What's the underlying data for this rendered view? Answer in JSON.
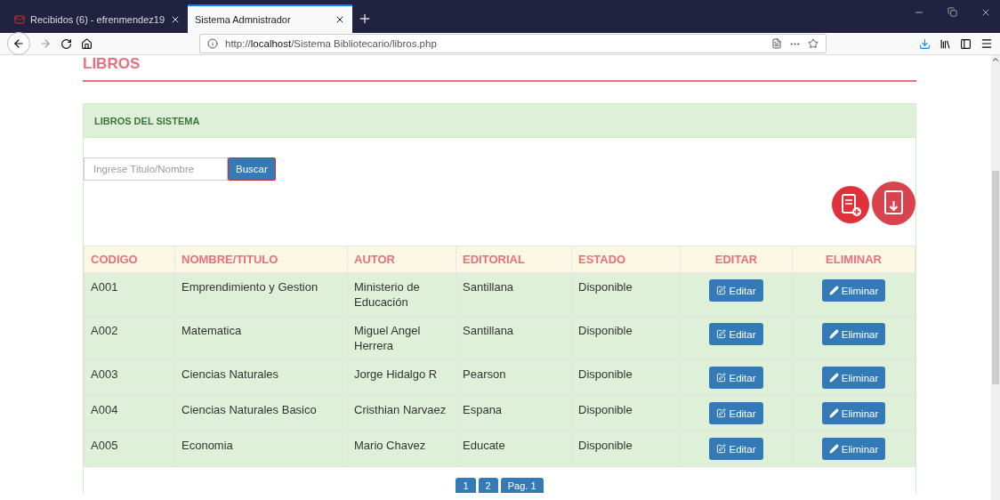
{
  "browser": {
    "tabs": [
      {
        "title": "Recibidos (6) - efrenmendez19",
        "selected": false
      },
      {
        "title": "Sistema Admnistrador",
        "selected": true
      }
    ],
    "url_prefix": "http://",
    "url_host": "localhost",
    "url_path": "/Sistema Bibliotecario/libros.php"
  },
  "page": {
    "heading": "LIBROS",
    "panel_title": "LIBROS DEL SISTEMA",
    "search": {
      "placeholder": "Ingrese Titulo/Nombre",
      "button": "Buscar"
    },
    "table": {
      "columns": [
        "CODIGO",
        "NOMBRE/TITULO",
        "AUTOR",
        "EDITORIAL",
        "ESTADO",
        "EDITAR",
        "ELIMINAR"
      ],
      "rows": [
        {
          "code": "A001",
          "title": "Emprendimiento y Gestion",
          "author": "Ministerio de Educación",
          "publisher": "Santillana",
          "status": "Disponible",
          "edit": "Editar",
          "delete": "Eliminar"
        },
        {
          "code": "A002",
          "title": "Matematica",
          "author": "Miguel Angel Herrera",
          "publisher": "Santillana",
          "status": "Disponible",
          "edit": "Editar",
          "delete": "Eliminar"
        },
        {
          "code": "A003",
          "title": "Ciencias Naturales",
          "author": "Jorge Hidalgo R",
          "publisher": "Pearson",
          "status": "Disponible",
          "edit": "Editar",
          "delete": "Eliminar"
        },
        {
          "code": "A004",
          "title": "Ciencias Naturales Basico",
          "author": "Cristhian Narvaez",
          "publisher": "Espana",
          "status": "Disponible",
          "edit": "Editar",
          "delete": "Eliminar"
        },
        {
          "code": "A005",
          "title": "Economia",
          "author": "Mario Chavez",
          "publisher": "Educate",
          "status": "Disponible",
          "edit": "Editar",
          "delete": "Eliminar"
        }
      ]
    },
    "pagination": [
      {
        "label": "1"
      },
      {
        "label": "2"
      },
      {
        "label": "Pag. 1"
      }
    ]
  }
}
